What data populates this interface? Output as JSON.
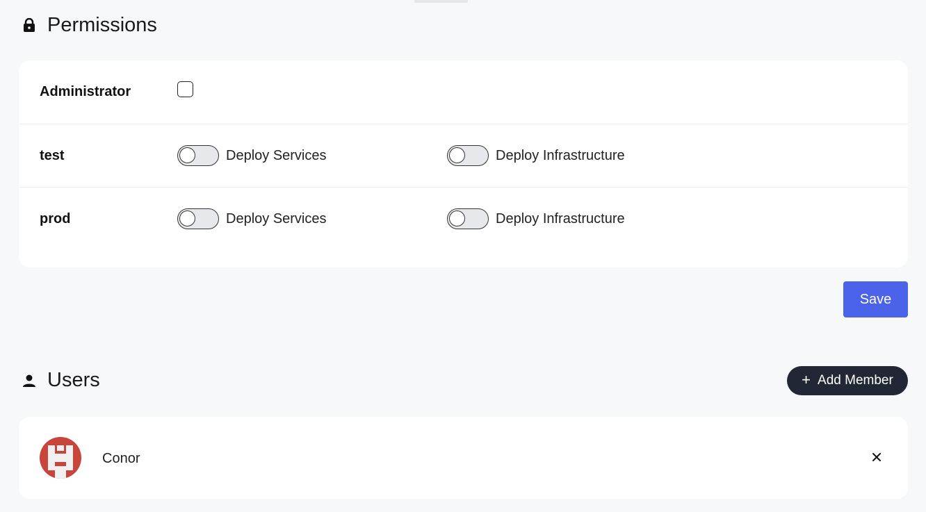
{
  "permissions": {
    "title": "Permissions",
    "icon": "lock-icon",
    "admin": {
      "label": "Administrator",
      "checked": false
    },
    "environments": [
      {
        "name": "test",
        "deploy_services": {
          "label": "Deploy Services",
          "enabled": false
        },
        "deploy_infrastructure": {
          "label": "Deploy Infrastructure",
          "enabled": false
        }
      },
      {
        "name": "prod",
        "deploy_services": {
          "label": "Deploy Services",
          "enabled": false
        },
        "deploy_infrastructure": {
          "label": "Deploy Infrastructure",
          "enabled": false
        }
      }
    ],
    "save_label": "Save"
  },
  "users": {
    "title": "Users",
    "icon": "person-icon",
    "add_member_label": "Add Member",
    "list": [
      {
        "name": "Conor",
        "avatar_color": "#c9443a"
      }
    ]
  },
  "colors": {
    "primary": "#4a63e8",
    "dark_button": "#222735",
    "background": "#f7f8fa"
  }
}
